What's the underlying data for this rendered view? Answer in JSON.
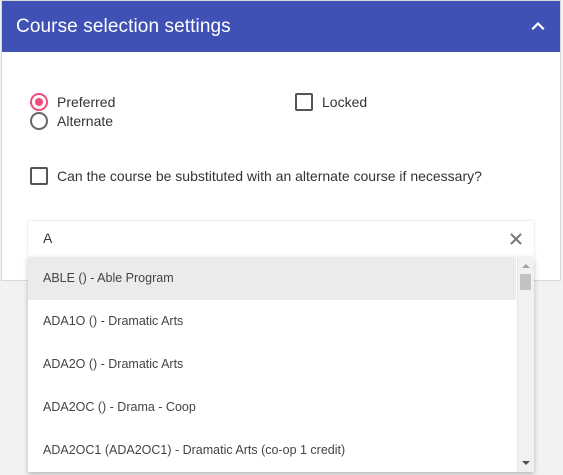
{
  "header": {
    "title": "Course selection settings",
    "background": "#3f51b5",
    "collapse_icon": "chevron-up-icon"
  },
  "options": {
    "preferred_label": "Preferred",
    "alternate_label": "Alternate",
    "locked_label": "Locked",
    "selected": "Preferred",
    "locked_checked": false
  },
  "substitute": {
    "label": "Can the course be substituted with an alternate course if necessary?",
    "checked": false
  },
  "search": {
    "value": "A",
    "clear_icon": "close-icon"
  },
  "dropdown": {
    "highlighted_index": 0,
    "items": [
      "ABLE () - Able Program",
      "ADA1O () - Dramatic Arts",
      "ADA2O () - Dramatic Arts",
      "ADA2OC () - Drama - Coop",
      "ADA2OC1 (ADA2OC1) - Dramatic Arts (co-op 1 credit)"
    ]
  },
  "colors": {
    "accent_radio": "#ef4d7e",
    "highlight_row": "#ebebeb"
  }
}
